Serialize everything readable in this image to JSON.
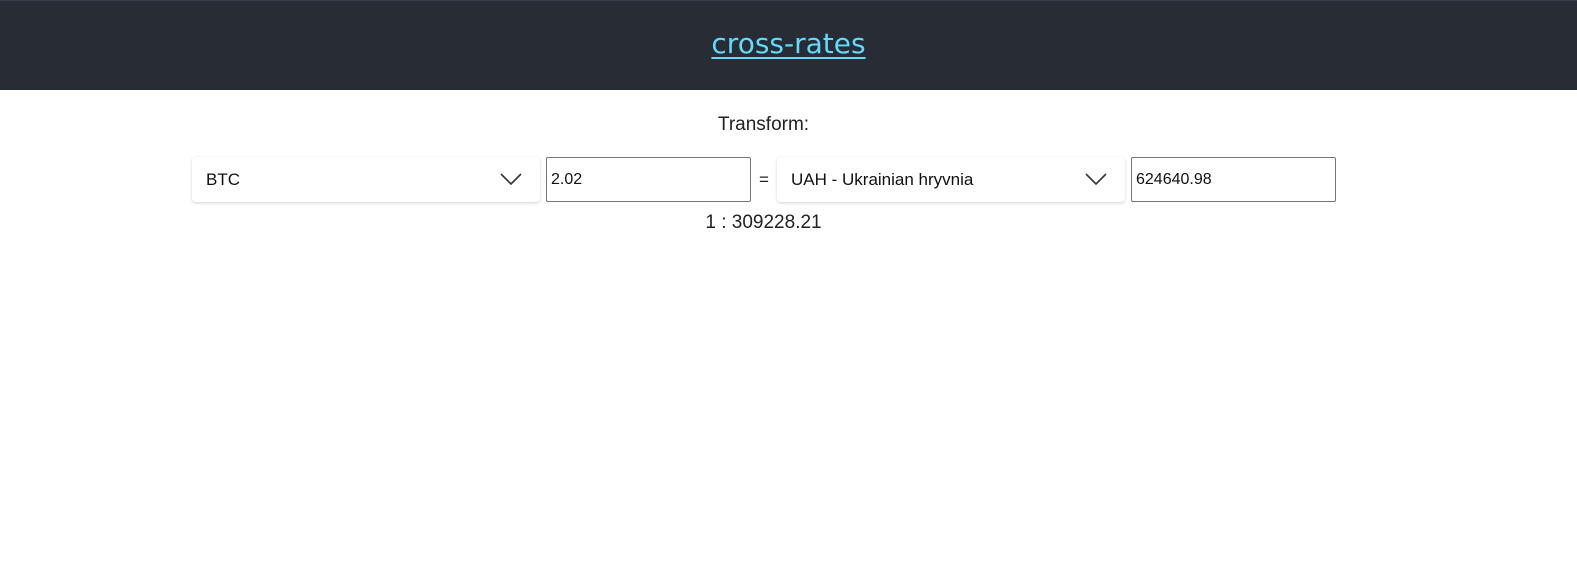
{
  "header": {
    "title": "cross-rates",
    "background": "#282c35",
    "link_color": "#61dafb"
  },
  "converter": {
    "label": "Transform:",
    "from_currency": "BTC",
    "from_amount": "2.02",
    "equals": "=",
    "to_currency": "UAH - Ukrainian hryvnia",
    "to_amount": "624640.98",
    "rate": "1 : 309228.21"
  },
  "icons": {
    "dropdown": "chevron-down-icon"
  }
}
